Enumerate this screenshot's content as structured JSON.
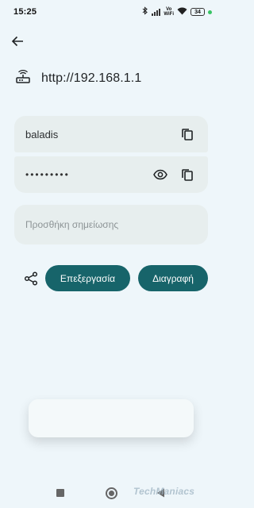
{
  "status_bar": {
    "time": "15:25",
    "vowifi_top": "Vo",
    "vowifi_bottom": "WiFi",
    "battery": "34",
    "dot_color": "#39c465"
  },
  "header": {
    "back_icon": "arrow-left-icon"
  },
  "entry": {
    "url_icon": "router-icon",
    "url": "http://192.168.1.1"
  },
  "credentials": {
    "username": "baladis",
    "password_masked": "•••••••••",
    "copy_icon": "copy-icon",
    "show_icon": "eye-icon"
  },
  "note": {
    "placeholder": "Προσθήκη σημείωσης",
    "value": ""
  },
  "actions": {
    "share_icon": "share-icon",
    "edit_label": "Επεξεργασία",
    "delete_label": "Διαγραφή",
    "accent_color": "#17646a"
  },
  "watermark": {
    "text": "TechManiacs"
  }
}
